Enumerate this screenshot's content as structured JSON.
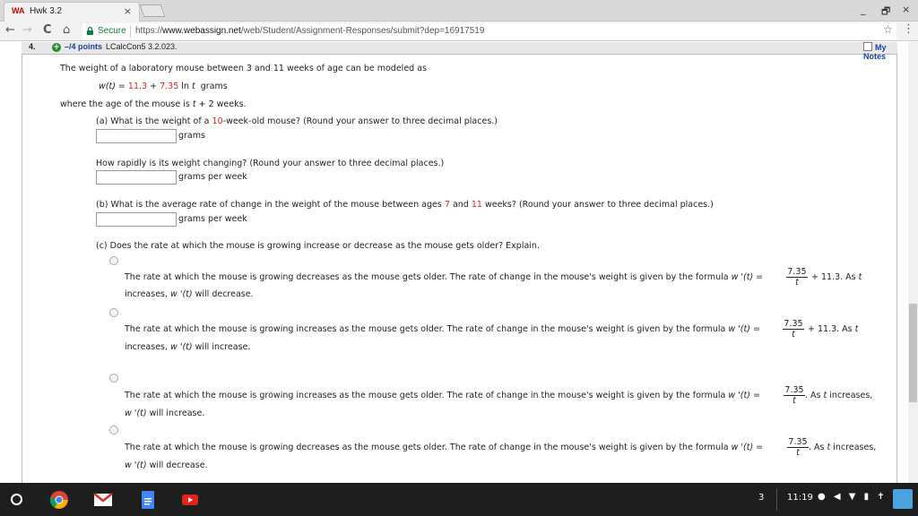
{
  "browser": {
    "tab_title": "Hwk 3.2",
    "tab_favicon": "WA",
    "tab_close": "×",
    "secure_label": "Secure",
    "url_prefix": "https://",
    "url_host": "www.webassign.net",
    "url_path": "/web/Student/Assignment-Responses/submit?dep=16917519",
    "win_min": "_",
    "win_restore": "🗗",
    "win_close": "×",
    "back_icon": "←",
    "forward_icon": "→",
    "reload_icon": "C",
    "home_icon": "⌂",
    "star_icon": "☆",
    "menu_icon": "⋮"
  },
  "question": {
    "number": "4.",
    "plus": "+",
    "points": "–/4 points",
    "code": "LCalcCon5 3.2.023.",
    "my_notes": "My Notes",
    "intro": "The weight of a laboratory mouse between 3 and 11 weeks of age can be modeled as",
    "formula_lhs": "w(t) =",
    "formula_a": "11.3",
    "formula_plus": "+",
    "formula_b": "7.35",
    "formula_ln": "ln",
    "formula_t": "t",
    "formula_units": "grams",
    "where": "where the age of the mouse is",
    "where_t": "t",
    "where_tail": "+ 2 weeks.",
    "part_a_pre": "(a) What is the weight of a",
    "part_a_val": "10",
    "part_a_post": "-week-old mouse? (Round your answer to three decimal places.)",
    "part_a_units": "grams",
    "part_a2": "How rapidly is its weight changing? (Round your answer to three decimal places.)",
    "part_a2_units": "grams per week",
    "part_b_pre": "(b) What is the average rate of change in the weight of the mouse between ages",
    "part_b_v1": "7",
    "part_b_and": "and",
    "part_b_v2": "11",
    "part_b_post": "weeks? (Round your answer to three decimal places.)",
    "part_b_units": "grams per week",
    "part_c": "(c) Does the rate at which the mouse is growing increase or decrease as the mouse gets older? Explain.",
    "options": [
      {
        "line1": "The rate at which the mouse is growing decreases as the mouse gets older. The rate of change in the mouse's weight is given by the formula",
        "wprime": "w '(t) =",
        "num": "7.35",
        "den": "t",
        "tail": "+ 11.3. As",
        "tail_t": "t",
        "line2_a": "increases,",
        "line2_w": "w '(t)",
        "line2_b": "will decrease."
      },
      {
        "line1": "The rate at which the mouse is growing increases as the mouse gets older. The rate of change in the mouse's weight is given by the formula",
        "wprime": "w '(t) =",
        "num": "7.35",
        "den": "t",
        "tail": "+ 11.3. As",
        "tail_t": "t",
        "line2_a": "increases,",
        "line2_w": "w '(t)",
        "line2_b": "will increase."
      },
      {
        "line1": "The rate at which the mouse is growing increases as the mouse gets older. The rate of change in the mouse's weight is given by the formula",
        "wprime": "w '(t) =",
        "num": "7.35",
        "den": "t",
        "tail": ". As",
        "tail_t": "t",
        "tail2": "increases,",
        "line2_w": "w '(t)",
        "line2_b": "will increase."
      },
      {
        "line1": "The rate at which the mouse is growing decreases as the mouse gets older. The rate of change in the mouse's weight is given by the formula",
        "wprime": "w '(t) =",
        "num": "7.35",
        "den": "t",
        "tail": ". As",
        "tail_t": "t",
        "tail2": "increases,",
        "line2_w": "w '(t)",
        "line2_b": "will decrease."
      }
    ]
  },
  "taskbar": {
    "notif_count": "3",
    "time": "11:19",
    "tray": "● ◀ ▼ ▮ ✝"
  }
}
